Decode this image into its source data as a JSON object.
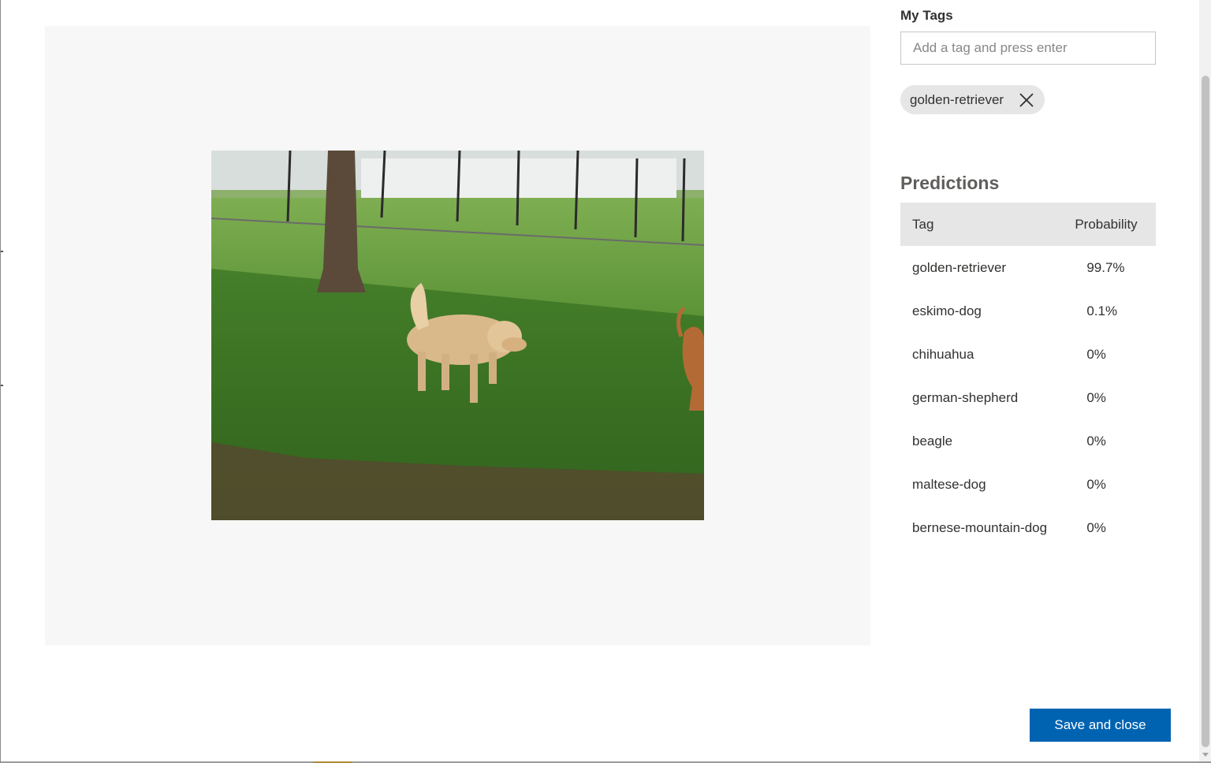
{
  "my_tags": {
    "label": "My Tags",
    "input_placeholder": "Add a tag and press enter",
    "input_value": "",
    "tags": [
      {
        "label": "golden-retriever",
        "remove_icon": "close-icon"
      }
    ]
  },
  "image": {
    "subject": "photo of a golden retriever walking on grass in a fenced park",
    "icon": "photo"
  },
  "predictions": {
    "title": "Predictions",
    "columns": {
      "tag": "Tag",
      "probability": "Probability"
    },
    "rows": [
      {
        "tag": "golden-retriever",
        "probability": "99.7%"
      },
      {
        "tag": "eskimo-dog",
        "probability": "0.1%"
      },
      {
        "tag": "chihuahua",
        "probability": "0%"
      },
      {
        "tag": "german-shepherd",
        "probability": "0%"
      },
      {
        "tag": "beagle",
        "probability": "0%"
      },
      {
        "tag": "maltese-dog",
        "probability": "0%"
      },
      {
        "tag": "bernese-mountain-dog",
        "probability": "0%"
      }
    ]
  },
  "footer": {
    "save_label": "Save and close"
  },
  "colors": {
    "primary_button": "#0063b1",
    "header_bg": "#e6e6e6",
    "viewer_bg": "#f7f7f7"
  }
}
